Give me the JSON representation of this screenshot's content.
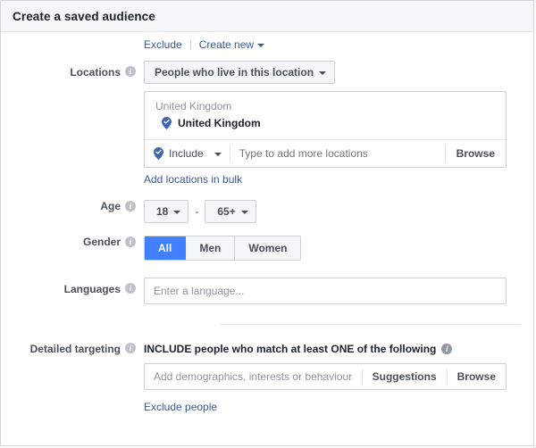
{
  "header": {
    "title": "Create a saved audience"
  },
  "colors": {
    "link_blue": "#3b5998",
    "pin_blue": "#4267b2",
    "selected_blue": "#4080ff",
    "header_bg": "#f5f6f7",
    "border": "#ccd0d5",
    "label_gray": "#4b4f56",
    "placeholder_gray": "#90949c"
  },
  "top_links": {
    "exclude_label": "Exclude",
    "create_new_label": "Create new"
  },
  "locations": {
    "label": "Locations",
    "dropdown_value": "People who live in this location",
    "group_label": "United Kingdom",
    "selected_items": [
      {
        "name": "United Kingdom"
      }
    ],
    "include_label": "Include",
    "typeahead_placeholder": "Type to add more locations",
    "browse_label": "Browse",
    "bulk_link_label": "Add locations in bulk"
  },
  "age": {
    "label": "Age",
    "min_value": "18",
    "max_value": "65+",
    "separator": "-"
  },
  "gender": {
    "label": "Gender",
    "options": [
      {
        "label": "All",
        "selected": true
      },
      {
        "label": "Men",
        "selected": false
      },
      {
        "label": "Women",
        "selected": false
      }
    ]
  },
  "languages": {
    "label": "Languages",
    "value": "",
    "placeholder": "Enter a language..."
  },
  "detailed_targeting": {
    "label": "Detailed targeting",
    "heading": "INCLUDE people who match at least ONE of the following",
    "input_value": "",
    "input_placeholder": "Add demographics, interests or behaviours",
    "suggestions_label": "Suggestions",
    "browse_label": "Browse",
    "exclude_link_label": "Exclude people"
  }
}
